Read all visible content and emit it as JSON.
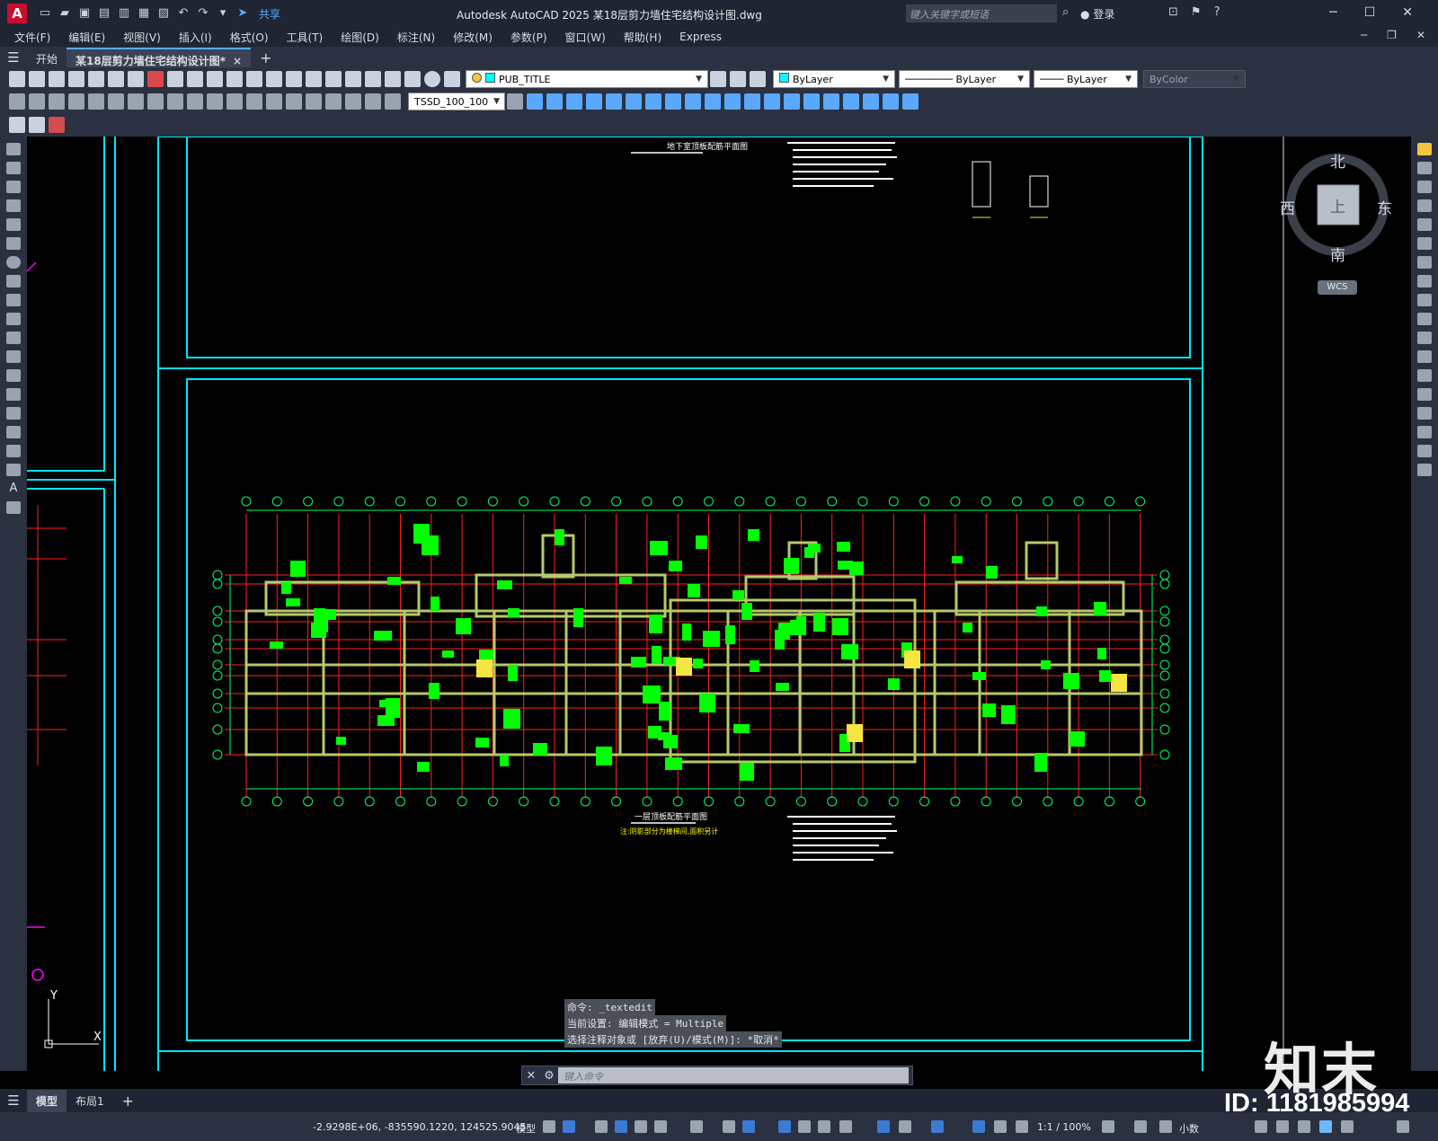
{
  "app": {
    "logo": "A",
    "title": "Autodesk AutoCAD 2025    某18层剪力墙住宅结构设计图.dwg",
    "share_label": "共享",
    "search_placeholder": "键入关键字或短语",
    "login_label": "登录"
  },
  "menu": [
    "文件(F)",
    "编辑(E)",
    "视图(V)",
    "插入(I)",
    "格式(O)",
    "工具(T)",
    "绘图(D)",
    "标注(N)",
    "修改(M)",
    "参数(P)",
    "窗口(W)",
    "帮助(H)",
    "Express"
  ],
  "tabs": {
    "start": "开始",
    "doc": "某18层剪力墙住宅结构设计图*",
    "close": "×",
    "add": "+"
  },
  "layers": {
    "layer_name": "PUB_TITLE",
    "color_value": "ByLayer",
    "linetype_value": "ByLayer",
    "lineweight_value": "ByLayer",
    "plotstyle_value": "ByColor",
    "dimstyle_value": "TSSD_100_100"
  },
  "compass": {
    "north": "北",
    "south": "南",
    "east": "东",
    "west": "西",
    "top": "上",
    "wcs": "WCS"
  },
  "drawing": {
    "title_basement": "地下室顶板配筋平面图",
    "title_floor1": "一层顶板配筋平面图",
    "subtitle_floor1": "注:阴影部分为楼梯间,面积另计",
    "ucs_y": "Y",
    "ucs_x": "X"
  },
  "command": {
    "history": [
      "命令: _textedit",
      "当前设置: 编辑模式 = Multiple",
      "选择注释对象或 [放弃(U)/模式(M)]: *取消*"
    ],
    "input_placeholder": "键入命令"
  },
  "layout_tabs": {
    "model": "模型",
    "layout1": "布局1",
    "add": "+"
  },
  "status": {
    "coords": "-2.9298E+06, -835590.1220, 124525.9045",
    "model": "模型",
    "scale": "1:1 / 100%",
    "units": "小数"
  },
  "overlay": {
    "id": "ID: 1181985994",
    "watermark": "知末"
  },
  "colors": {
    "accent": "#5aa8ff",
    "frame": "#00e5ff",
    "grid": "#ff2020",
    "tag": "#00ff00"
  }
}
